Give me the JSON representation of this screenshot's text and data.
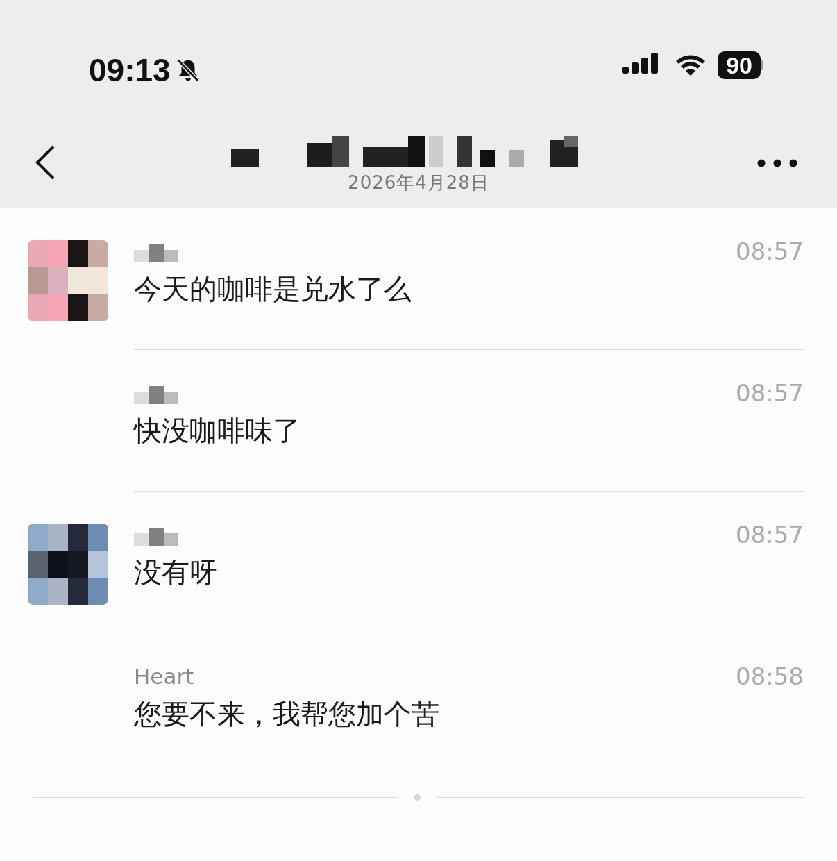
{
  "status_bar": {
    "time": "09:13",
    "muted": true,
    "battery": "90"
  },
  "header": {
    "title": {
      "kind": "hidden"
    },
    "date": "2026年4月28日"
  },
  "messages": [
    {
      "sender": {
        "kind": "hidden"
      },
      "time": "08:57",
      "text": "今天的咖啡是兑水了么"
    },
    {
      "sender": {
        "kind": "hidden"
      },
      "time": "08:57",
      "text": "快没咖啡味了"
    },
    {
      "sender": {
        "kind": "hidden"
      },
      "time": "08:57",
      "text": "没有呀"
    },
    {
      "sender": {
        "kind": "text",
        "text": "Heart"
      },
      "time": "08:58",
      "text": "您要不来，我帮您加个苦"
    }
  ]
}
